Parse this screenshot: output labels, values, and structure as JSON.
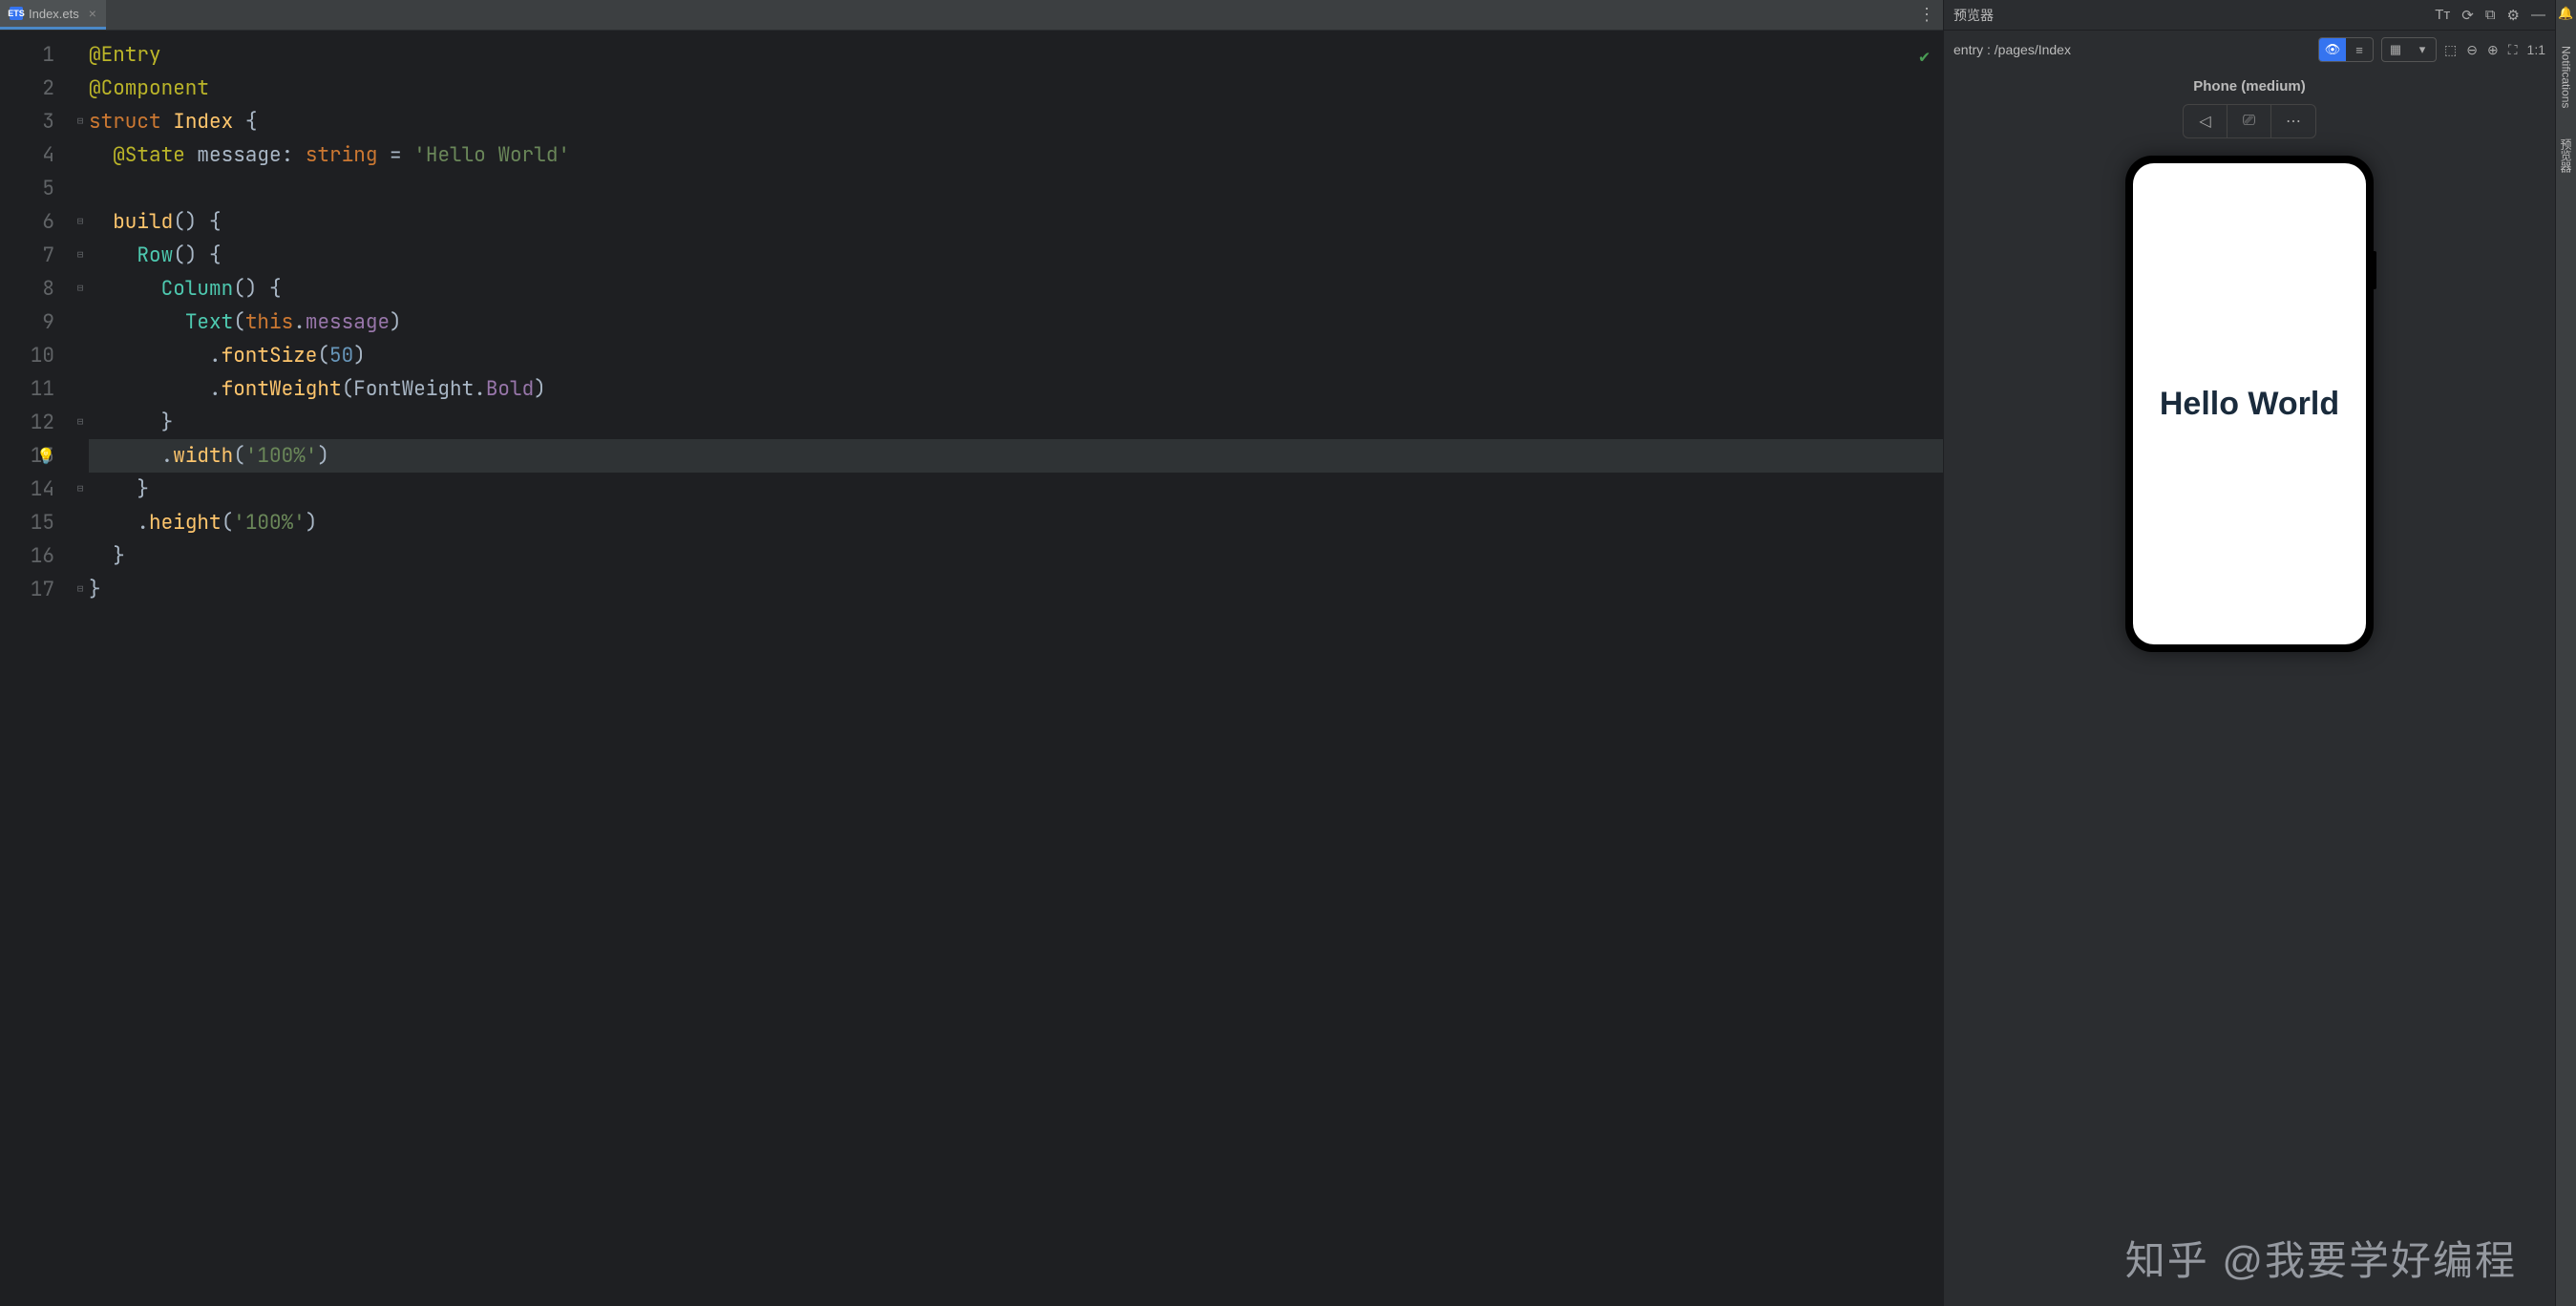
{
  "tab": {
    "filename": "Index.ets",
    "icon": "ETS"
  },
  "code": {
    "lines": [
      1,
      2,
      3,
      4,
      5,
      6,
      7,
      8,
      9,
      10,
      11,
      12,
      13,
      14,
      15,
      16,
      17
    ],
    "l1_entry": "@Entry",
    "l2_comp": "@Component",
    "l3_struct": "struct",
    "l3_name": "Index",
    "l3_brace": " {",
    "l4_state": "@State",
    "l4_msg": " message",
    "l4_colon": ": ",
    "l4_type": "string",
    "l4_eq": " = ",
    "l4_str": "'Hello World'",
    "l6_build": "build",
    "l6_pb": "() {",
    "l7_row": "Row",
    "l7_pb": "() {",
    "l8_col": "Column",
    "l8_pb": "() {",
    "l9_text": "Text",
    "l9_op": "(",
    "l9_this": "this",
    "l9_dot": ".",
    "l9_msg": "message",
    "l9_cp": ")",
    "l10_dot": ".",
    "l10_fs": "fontSize",
    "l10_op": "(",
    "l10_num": "50",
    "l10_cp": ")",
    "l11_dot": ".",
    "l11_fw": "fontWeight",
    "l11_op": "(",
    "l11_enum": "FontWeight",
    "l11_dot2": ".",
    "l11_bold": "Bold",
    "l11_cp": ")",
    "l12_cb": "}",
    "l13_dot": ".",
    "l13_w": "width",
    "l13_op": "(",
    "l13_str": "'100%'",
    "l13_cp": ")",
    "l14_cb": "}",
    "l15_dot": ".",
    "l15_h": "height",
    "l15_op": "(",
    "l15_str": "'100%'",
    "l15_cp": ")",
    "l16_cb": "}",
    "l17_cb": "}"
  },
  "preview": {
    "title": "预览器",
    "entry": "entry : /pages/Index",
    "device": "Phone (medium)",
    "message": "Hello World",
    "zoom": "1:1"
  },
  "siderail": {
    "notifications": "Notifications",
    "previewer": "预览器"
  },
  "watermark": "知乎 @我要学好编程"
}
